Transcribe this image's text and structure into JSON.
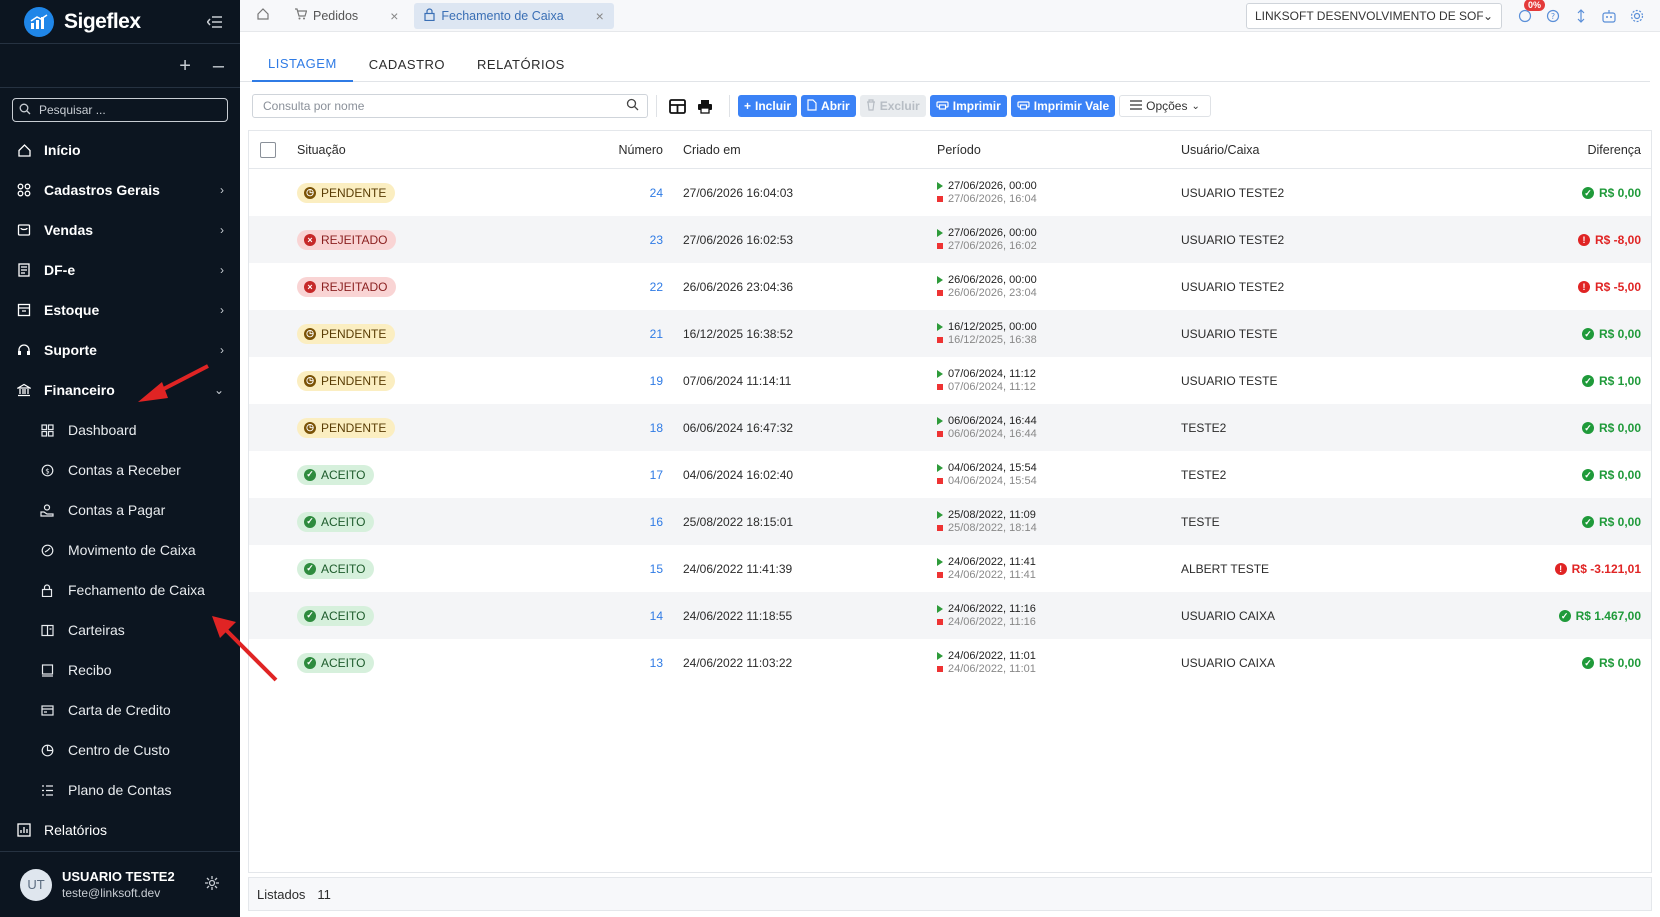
{
  "brand": {
    "name": "Sigeflex"
  },
  "sidebar": {
    "search_placeholder": "Pesquisar ...",
    "items": [
      {
        "label": "Início",
        "icon": "home-icon",
        "chevron": false
      },
      {
        "label": "Cadastros Gerais",
        "icon": "grid-icon",
        "chevron": true
      },
      {
        "label": "Vendas",
        "icon": "cart-icon",
        "chevron": true
      },
      {
        "label": "DF-e",
        "icon": "document-icon",
        "chevron": true
      },
      {
        "label": "Estoque",
        "icon": "box-icon",
        "chevron": true
      },
      {
        "label": "Suporte",
        "icon": "headset-icon",
        "chevron": true
      },
      {
        "label": "Financeiro",
        "icon": "bank-icon",
        "chevron": true,
        "expanded": true
      }
    ],
    "sub_items": [
      {
        "label": "Dashboard",
        "icon": "dashboard-icon"
      },
      {
        "label": "Contas a Receber",
        "icon": "coin-icon"
      },
      {
        "label": "Contas a Pagar",
        "icon": "hand-coin-icon"
      },
      {
        "label": "Movimento de Caixa",
        "icon": "gauge-icon"
      },
      {
        "label": "Fechamento de Caixa",
        "icon": "lock-icon"
      },
      {
        "label": "Carteiras",
        "icon": "wallet-icon"
      },
      {
        "label": "Recibo",
        "icon": "receipt-icon"
      },
      {
        "label": "Carta de Credito",
        "icon": "card-icon"
      },
      {
        "label": "Centro de Custo",
        "icon": "pie-icon"
      },
      {
        "label": "Plano de Contas",
        "icon": "list-icon"
      }
    ],
    "reports_label": "Relatórios"
  },
  "user": {
    "initials": "UT",
    "name": "USUARIO TESTE2",
    "email": "teste@linksoft.dev"
  },
  "topbar": {
    "tabs": [
      {
        "label": "Pedidos",
        "icon": "cart-icon",
        "active": false
      },
      {
        "label": "Fechamento de Caixa",
        "icon": "lock-icon",
        "active": true
      }
    ],
    "company": "LINKSOFT DESENVOLVIMENTO DE SOFT...",
    "badge": "0%"
  },
  "main_tabs": [
    "LISTAGEM",
    "CADASTRO",
    "RELATÓRIOS"
  ],
  "toolbar": {
    "search_placeholder": "Consulta por nome",
    "include": "Incluir",
    "open": "Abrir",
    "delete": "Excluir",
    "print": "Imprimir",
    "print_voucher": "Imprimir Vale",
    "options": "Opções"
  },
  "table": {
    "headers": {
      "situacao": "Situação",
      "numero": "Número",
      "criado": "Criado em",
      "periodo": "Período",
      "usuario": "Usuário/Caixa",
      "diferenca": "Diferença"
    },
    "rows": [
      {
        "status": "PENDENTE",
        "kind": "pend",
        "numero": "24",
        "criado": "27/06/2026 16:04:03",
        "per_start": "27/06/2026, 00:00",
        "per_end": "27/06/2026, 16:04",
        "usuario": "USUARIO TESTE2",
        "diferenca": "R$ 0,00",
        "sign": "pos"
      },
      {
        "status": "REJEITADO",
        "kind": "rej",
        "numero": "23",
        "criado": "27/06/2026 16:02:53",
        "per_start": "27/06/2026, 00:00",
        "per_end": "27/06/2026, 16:02",
        "usuario": "USUARIO TESTE2",
        "diferenca": "R$ -8,00",
        "sign": "neg"
      },
      {
        "status": "REJEITADO",
        "kind": "rej",
        "numero": "22",
        "criado": "26/06/2026 23:04:36",
        "per_start": "26/06/2026, 00:00",
        "per_end": "26/06/2026, 23:04",
        "usuario": "USUARIO TESTE2",
        "diferenca": "R$ -5,00",
        "sign": "neg"
      },
      {
        "status": "PENDENTE",
        "kind": "pend",
        "numero": "21",
        "criado": "16/12/2025 16:38:52",
        "per_start": "16/12/2025, 00:00",
        "per_end": "16/12/2025, 16:38",
        "usuario": "USUARIO TESTE",
        "diferenca": "R$ 0,00",
        "sign": "pos"
      },
      {
        "status": "PENDENTE",
        "kind": "pend",
        "numero": "19",
        "criado": "07/06/2024 11:14:11",
        "per_start": "07/06/2024, 11:12",
        "per_end": "07/06/2024, 11:12",
        "usuario": "USUARIO TESTE",
        "diferenca": "R$ 1,00",
        "sign": "pos"
      },
      {
        "status": "PENDENTE",
        "kind": "pend",
        "numero": "18",
        "criado": "06/06/2024 16:47:32",
        "per_start": "06/06/2024, 16:44",
        "per_end": "06/06/2024, 16:44",
        "usuario": "TESTE2",
        "diferenca": "R$ 0,00",
        "sign": "pos"
      },
      {
        "status": "ACEITO",
        "kind": "ace",
        "numero": "17",
        "criado": "04/06/2024 16:02:40",
        "per_start": "04/06/2024, 15:54",
        "per_end": "04/06/2024, 15:54",
        "usuario": "TESTE2",
        "diferenca": "R$ 0,00",
        "sign": "pos"
      },
      {
        "status": "ACEITO",
        "kind": "ace",
        "numero": "16",
        "criado": "25/08/2022 18:15:01",
        "per_start": "25/08/2022, 11:09",
        "per_end": "25/08/2022, 18:14",
        "usuario": "TESTE",
        "diferenca": "R$ 0,00",
        "sign": "pos"
      },
      {
        "status": "ACEITO",
        "kind": "ace",
        "numero": "15",
        "criado": "24/06/2022 11:41:39",
        "per_start": "24/06/2022, 11:41",
        "per_end": "24/06/2022, 11:41",
        "usuario": "ALBERT TESTE",
        "diferenca": "R$ -3.121,01",
        "sign": "neg"
      },
      {
        "status": "ACEITO",
        "kind": "ace",
        "numero": "14",
        "criado": "24/06/2022 11:18:55",
        "per_start": "24/06/2022, 11:16",
        "per_end": "24/06/2022, 11:16",
        "usuario": "USUARIO CAIXA",
        "diferenca": "R$ 1.467,00",
        "sign": "pos"
      },
      {
        "status": "ACEITO",
        "kind": "ace",
        "numero": "13",
        "criado": "24/06/2022 11:03:22",
        "per_start": "24/06/2022, 11:01",
        "per_end": "24/06/2022, 11:01",
        "usuario": "USUARIO CAIXA",
        "diferenca": "R$ 0,00",
        "sign": "pos"
      }
    ]
  },
  "footer": {
    "label": "Listados",
    "count": "11"
  },
  "colors": {
    "sidebar_bg": "#0c1520",
    "accent": "#2f7be5",
    "button": "#3b82f6",
    "positive": "#1f9a3a",
    "negative": "#e02424",
    "arrow": "#e02424"
  }
}
